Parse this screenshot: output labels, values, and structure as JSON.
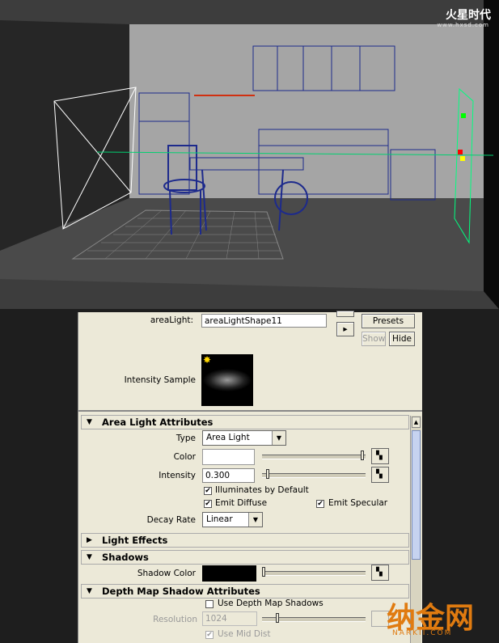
{
  "watermark_top": {
    "brand": "火星时代",
    "url": "www.hxsd.com"
  },
  "attribute_editor": {
    "node_label": "areaLight:",
    "node_value": "areaLightShape11",
    "presets_button": "Presets",
    "show_button": "Show",
    "hide_button": "Hide",
    "intensity_sample_label": "Intensity Sample"
  },
  "area_light_attributes": {
    "header": "Area Light Attributes",
    "type_label": "Type",
    "type_value": "Area Light",
    "color_label": "Color",
    "color_value": "#ffffff",
    "intensity_label": "Intensity",
    "intensity_value": "0.300",
    "illuminates_by_default": "Illuminates by Default",
    "emit_diffuse": "Emit Diffuse",
    "emit_specular": "Emit Specular",
    "decay_rate_label": "Decay Rate",
    "decay_rate_value": "Linear"
  },
  "light_effects": {
    "header": "Light Effects"
  },
  "shadows": {
    "header": "Shadows",
    "shadow_color_label": "Shadow Color",
    "shadow_color_value": "#000000"
  },
  "depth_map": {
    "header": "Depth Map Shadow Attributes",
    "use_depth_map": "Use Depth Map Shadows",
    "resolution_label": "Resolution",
    "resolution_value": "1024",
    "use_mid_dist": "Use Mid Dist"
  },
  "watermark_bottom": {
    "brand": "纳金网",
    "url": "NARKII.COM"
  },
  "colors": {
    "viewport_bg": "#3d3d3d",
    "wireframe": "#1d2a8c",
    "light_manip": "#00ff80",
    "panel_bg": "#ece9d8"
  }
}
